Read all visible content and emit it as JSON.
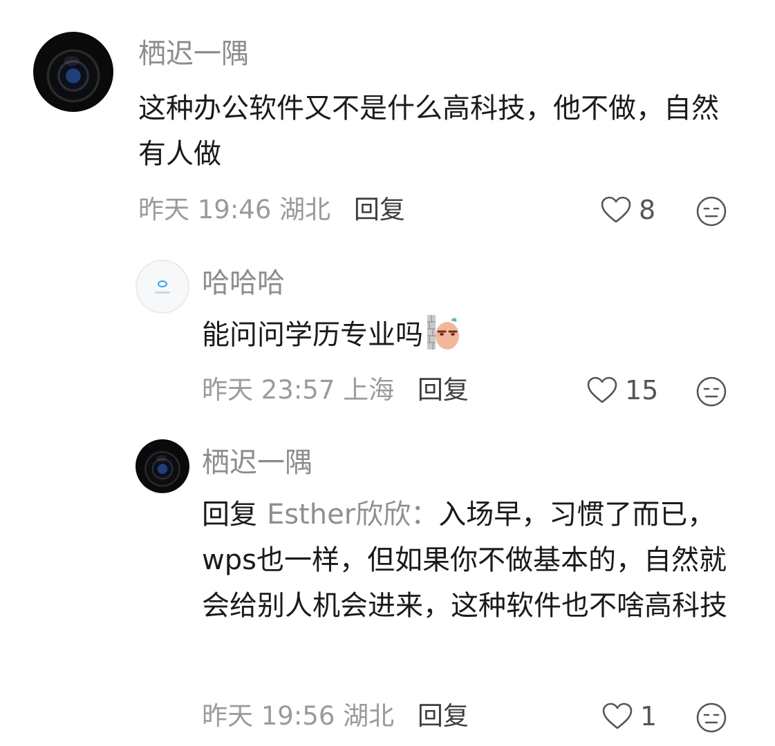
{
  "comments": [
    {
      "username": "栖迟一隅",
      "text": "这种办公软件又不是什么高科技，他不做，自然有人做",
      "time": "昨天 19:46",
      "location": "湖北",
      "reply_label": "回复",
      "likes": "8",
      "avatar_icon": "camera-lens-avatar"
    },
    {
      "username": "哈哈哈",
      "text": "能问问学历专业吗",
      "sticker_icon": "peeking-peanut-sticker",
      "time": "昨天 23:57",
      "location": "上海",
      "reply_label": "回复",
      "likes": "15",
      "avatar_icon": "default-app-avatar"
    },
    {
      "username": "栖迟一隅",
      "reply_prefix": "回复",
      "mention": "Esther欣欣：",
      "text": "入场早，习惯了而已，wps也一样，但如果你不做基本的，自然就会给别人机会进来，这种软件也不啥高科技",
      "time": "昨天 19:56",
      "location": "湖北",
      "reply_label": "回复",
      "likes": "1",
      "avatar_icon": "camera-lens-avatar"
    }
  ],
  "icons": {
    "like": "heart-outline-icon",
    "reaction": "neutral-face-icon"
  },
  "colors": {
    "username": "#8c8c8c",
    "text": "#1a1a1a",
    "meta": "#9a9a9a",
    "reply": "#3d3d3d"
  }
}
